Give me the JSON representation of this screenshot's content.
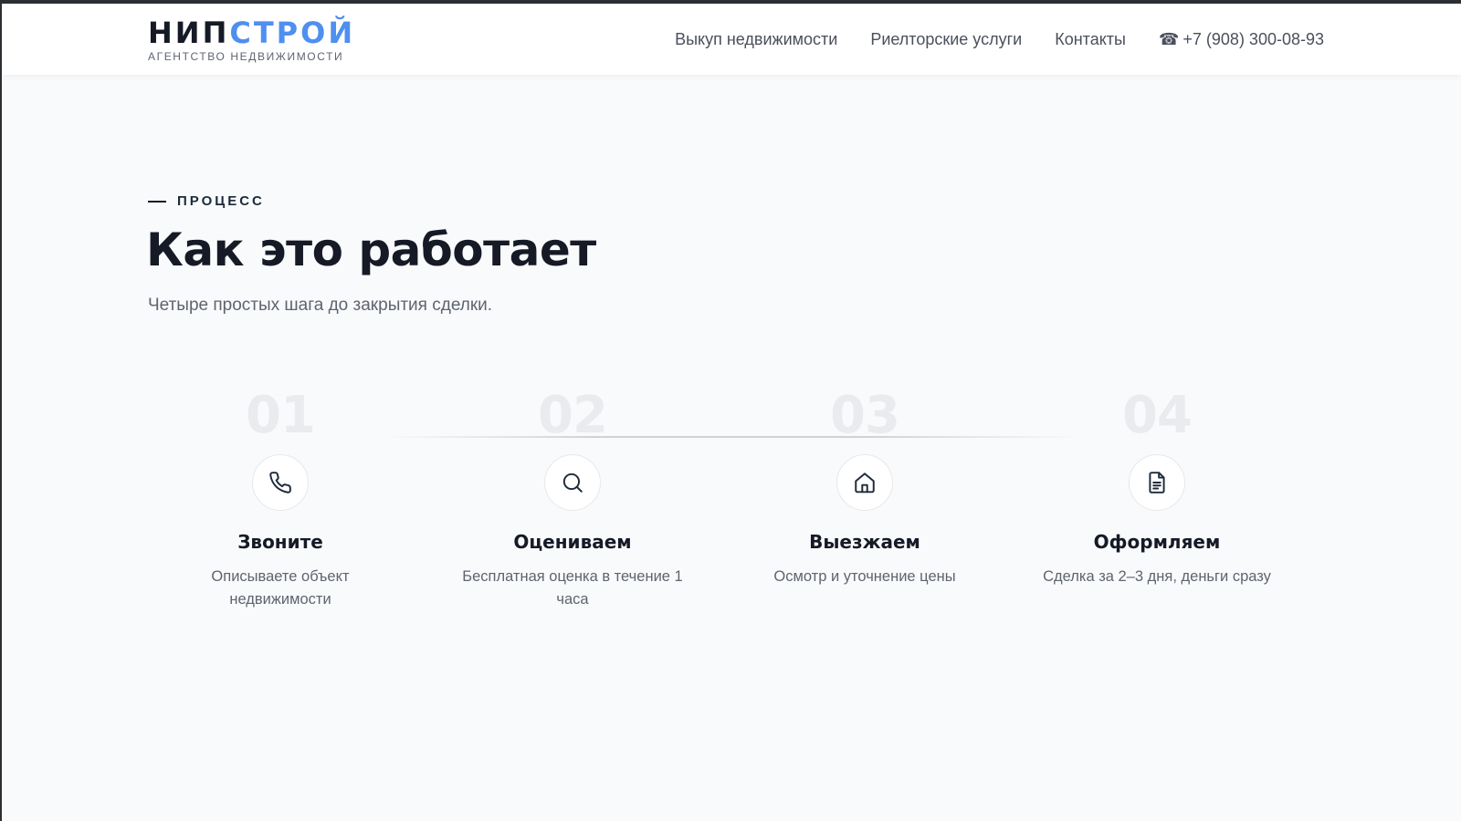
{
  "header": {
    "logo": {
      "part1": "НИП",
      "part2": "СТРОЙ",
      "subtitle": "АГЕНТСТВО НЕДВИЖИМОСТИ",
      "accent_color": "#4f8ff0"
    },
    "nav": {
      "items": [
        {
          "label": "Выкуп недвижимости"
        },
        {
          "label": "Риелторские услуги"
        },
        {
          "label": "Контакты"
        }
      ],
      "phone": {
        "icon": "phone-icon",
        "glyph": "☎",
        "number": "+7 (908) 300-08-93"
      }
    }
  },
  "process": {
    "eyebrow": "ПРОЦЕСС",
    "title": "Как это работает",
    "subtitle": "Четыре простых шага до закрытия сделки.",
    "steps": [
      {
        "number": "01",
        "icon": "phone-icon",
        "title": "Звоните",
        "description": "Описываете объект недвижимости"
      },
      {
        "number": "02",
        "icon": "search-icon",
        "title": "Оцениваем",
        "description": "Бесплатная оценка в течение 1 часа"
      },
      {
        "number": "03",
        "icon": "home-icon",
        "title": "Выезжаем",
        "description": "Осмотр и уточнение цены"
      },
      {
        "number": "04",
        "icon": "document-icon",
        "title": "Оформляем",
        "description": "Сделка за 2–3 дня, деньги сразу"
      }
    ]
  }
}
